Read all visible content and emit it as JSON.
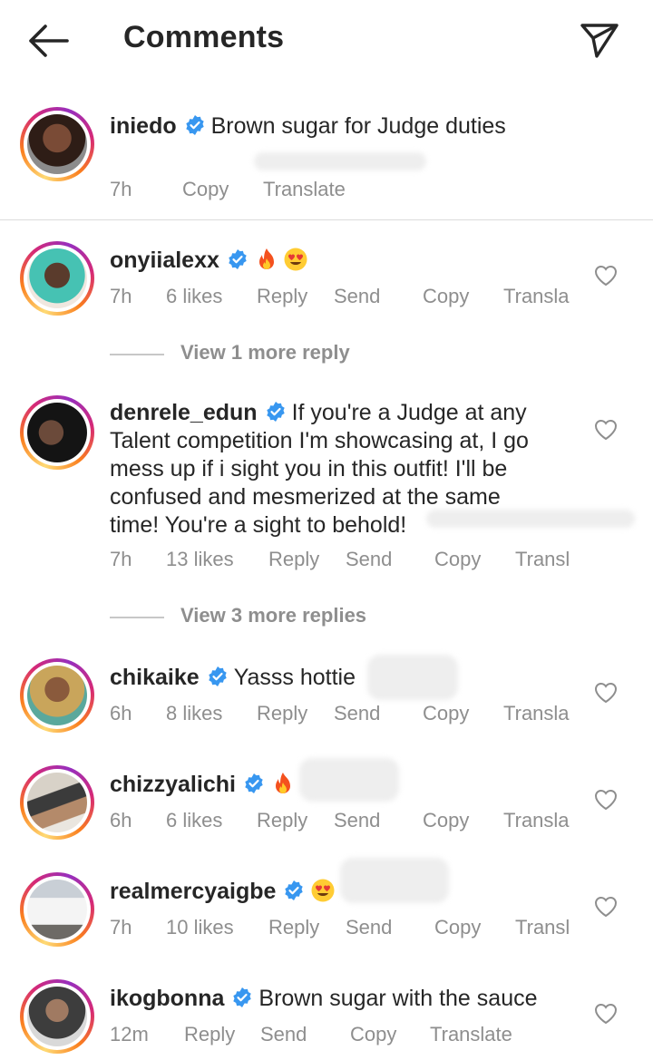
{
  "header": {
    "title": "Comments"
  },
  "post": {
    "username": "iniedo",
    "text": "Brown sugar for Judge duties",
    "meta": {
      "time": "7h",
      "copy": "Copy",
      "translate": "Translate"
    }
  },
  "comments": [
    {
      "username": "onyiialexx",
      "text": "",
      "time": "7h",
      "likes": "6 likes",
      "reply": "Reply",
      "send": "Send",
      "copy": "Copy",
      "translate": "Transla"
    },
    {
      "username": "denrele_edun",
      "text": "If you're a Judge at any",
      "text_lines": [
        "Talent competition I'm showcasing at, I go",
        "mess up if i sight you in this outfit! I'll be",
        "confused and mesmerized at the same",
        "time! You're a sight to behold!"
      ],
      "time": "7h",
      "likes": "13 likes",
      "reply": "Reply",
      "send": "Send",
      "copy": "Copy",
      "translate": "Transl"
    },
    {
      "username": "chikaike",
      "text": "Yasss hottie",
      "time": "6h",
      "likes": "8 likes",
      "reply": "Reply",
      "send": "Send",
      "copy": "Copy",
      "translate": "Transla"
    },
    {
      "username": "chizzyalichi",
      "text": "",
      "time": "6h",
      "likes": "6 likes",
      "reply": "Reply",
      "send": "Send",
      "copy": "Copy",
      "translate": "Transla"
    },
    {
      "username": "realmercyaigbe",
      "text": "",
      "time": "7h",
      "likes": "10 likes",
      "reply": "Reply",
      "send": "Send",
      "copy": "Copy",
      "translate": "Transl"
    },
    {
      "username": "ikogbonna",
      "text": "Brown sugar with the sauce",
      "time": "12m",
      "reply": "Reply",
      "send": "Send",
      "copy": "Copy",
      "translate": "Translate"
    }
  ],
  "view_more": [
    "View 1 more reply",
    "View 3 more replies"
  ],
  "icons": {
    "back": "arrow-left-icon",
    "share": "paper-plane-icon",
    "verified": "verified-badge-icon",
    "like": "heart-outline-icon",
    "fire": "fire-emoji",
    "heart_eyes": "heart-eyes-emoji"
  },
  "colors": {
    "verified": "#3897f0",
    "muted": "#8e8e8e",
    "text": "#262626"
  }
}
